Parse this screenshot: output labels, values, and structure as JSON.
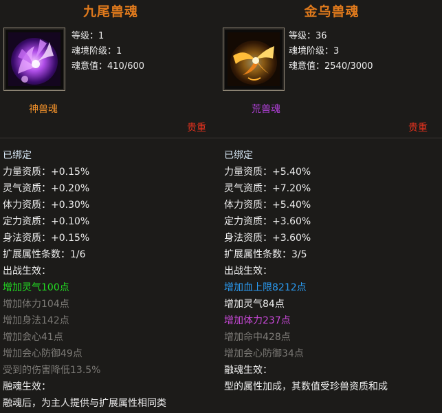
{
  "left": {
    "title": "九尾兽魂",
    "icon": "nine-tail-fox-spirit-icon",
    "stats": {
      "level": "等级：1",
      "realm": "魂境阶级：1",
      "soul_value": "魂意值：410/600"
    },
    "type_label": "神兽魂",
    "type_color": "#f0902a",
    "rarity": "贵重",
    "lines": [
      {
        "text": "已绑定",
        "color": "bound"
      },
      {
        "text": "力量资质：+0.15%",
        "color": "white"
      },
      {
        "text": "灵气资质：+0.20%",
        "color": "white"
      },
      {
        "text": "体力资质：+0.30%",
        "color": "white"
      },
      {
        "text": "定力资质：+0.10%",
        "color": "white"
      },
      {
        "text": "身法资质：+0.15%",
        "color": "white"
      },
      {
        "text": "扩展属性条数：1/6",
        "color": "white"
      },
      {
        "text": "出战生效：",
        "color": "white"
      },
      {
        "text": "增加灵气100点",
        "color": "green"
      },
      {
        "text": "增加体力104点",
        "color": "grey"
      },
      {
        "text": "增加身法142点",
        "color": "grey"
      },
      {
        "text": "增加会心41点",
        "color": "grey"
      },
      {
        "text": "增加会心防御49点",
        "color": "grey"
      },
      {
        "text": "受到的伤害降低13.5%",
        "color": "grey"
      },
      {
        "text": "融魂生效：",
        "color": "white"
      },
      {
        "text": "融魂后，为主人提供与扩展属性相同类",
        "color": "white"
      }
    ]
  },
  "right": {
    "title": "金乌兽魂",
    "icon": "golden-crow-spirit-icon",
    "stats": {
      "level": "等级：36",
      "realm": "魂境阶级：3",
      "soul_value": "魂意值：2540/3000"
    },
    "type_label": "荒兽魂",
    "type_color": "#b040d8",
    "rarity": "贵重",
    "lines": [
      {
        "text": "已绑定",
        "color": "bound"
      },
      {
        "text": "力量资质：+5.40%",
        "color": "white"
      },
      {
        "text": "灵气资质：+7.20%",
        "color": "white"
      },
      {
        "text": "体力资质：+5.40%",
        "color": "white"
      },
      {
        "text": "定力资质：+3.60%",
        "color": "white"
      },
      {
        "text": "身法资质：+3.60%",
        "color": "white"
      },
      {
        "text": "扩展属性条数：3/5",
        "color": "white"
      },
      {
        "text": "出战生效：",
        "color": "white"
      },
      {
        "text": "增加血上限8212点",
        "color": "blue"
      },
      {
        "text": "增加灵气84点",
        "color": "white"
      },
      {
        "text": "增加体力237点",
        "color": "purple"
      },
      {
        "text": "增加命中428点",
        "color": "grey"
      },
      {
        "text": "增加会心防御34点",
        "color": "grey"
      },
      {
        "text": "融魂生效：",
        "color": "white"
      },
      {
        "text": "型的属性加成，其数值受珍兽资质和成",
        "color": "white"
      }
    ]
  }
}
